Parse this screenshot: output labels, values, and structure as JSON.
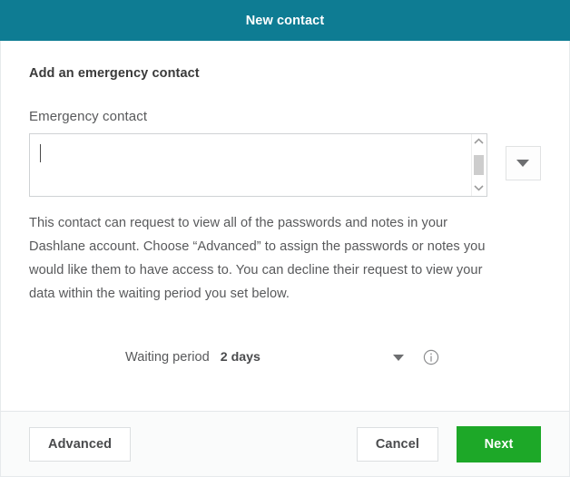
{
  "window": {
    "title": "New contact",
    "titlebar_color": "#0E7C93"
  },
  "main": {
    "section_title": "Add an emergency contact",
    "field_label": "Emergency contact",
    "contact_input": {
      "value": "",
      "placeholder": ""
    },
    "contact_dropdown_icon": "chevron-down-icon",
    "description": "This contact can request to view all of the passwords and notes in your Dashlane account. Choose “Advanced” to assign the passwords or notes you would like them to have access to. You can decline their request to view your data within the waiting period you set below.",
    "waiting_period": {
      "label": "Waiting period",
      "value": "2 days",
      "dropdown_icon": "chevron-down-icon",
      "info_icon": "info-circle-icon"
    },
    "scrollbar": {
      "up_icon": "chevron-up-icon",
      "down_icon": "chevron-down-icon"
    }
  },
  "footer": {
    "advanced_label": "Advanced",
    "cancel_label": "Cancel",
    "next_label": "Next",
    "next_color": "#1DA828"
  }
}
